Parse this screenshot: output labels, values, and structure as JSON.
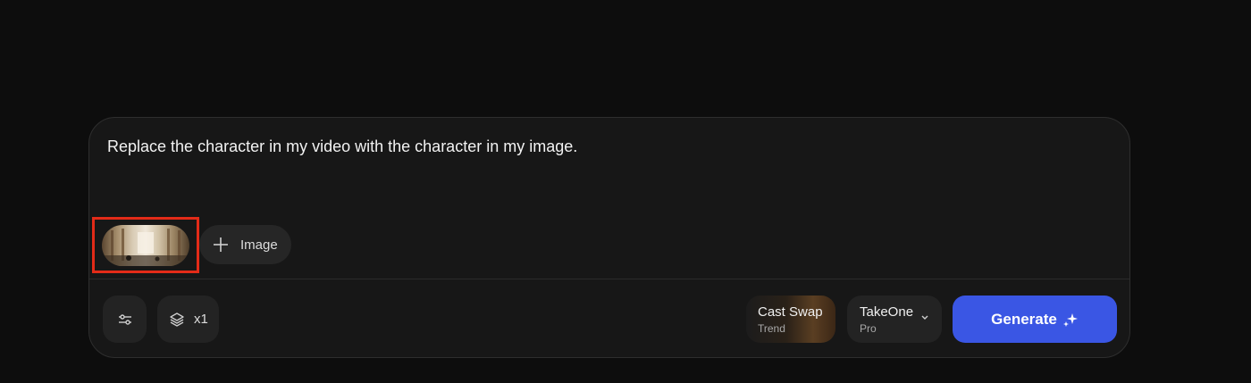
{
  "prompt": {
    "text": "Replace the character in my video with the character in my image."
  },
  "attachments": {
    "thumbnail_label": "attached-image-thumbnail",
    "add_image_label": "Image"
  },
  "toolbar": {
    "count_label": "x1"
  },
  "model": {
    "name": "Cast Swap",
    "tag": "Trend"
  },
  "version": {
    "name": "TakeOne",
    "tier": "Pro"
  },
  "generate": {
    "label": "Generate"
  },
  "colors": {
    "background": "#0d0d0d",
    "panel": "#171717",
    "accent": "#3a56e4",
    "highlight": "#e32b18"
  }
}
